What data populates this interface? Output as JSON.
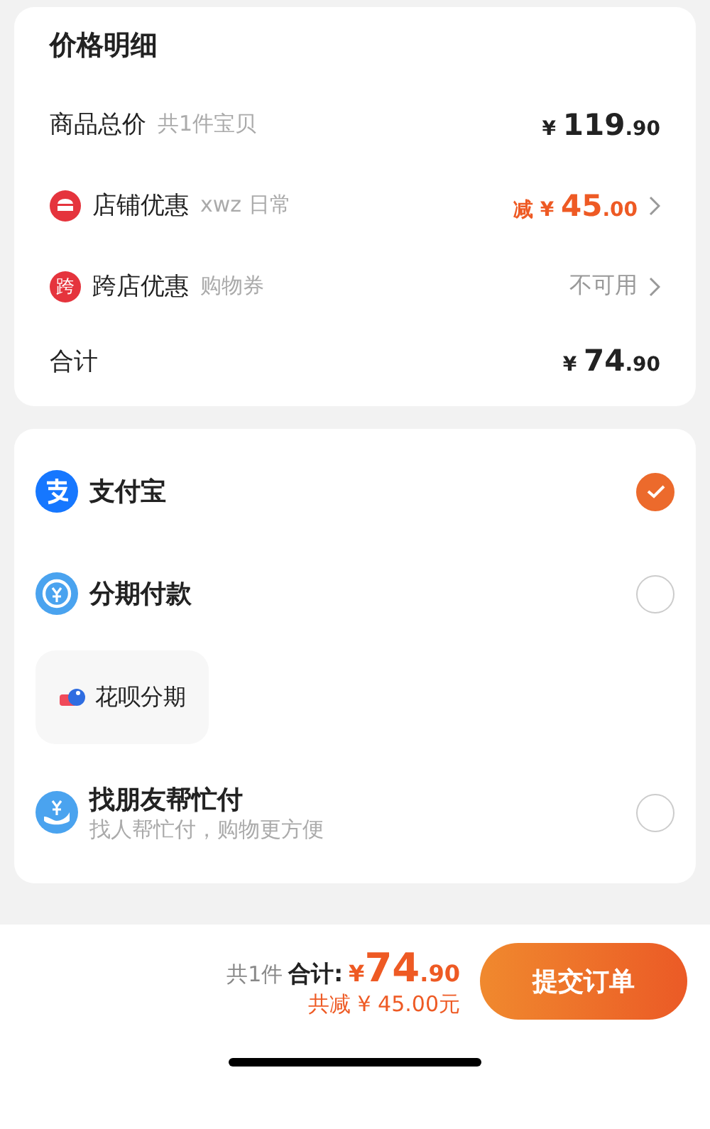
{
  "price_details": {
    "title": "价格明细",
    "rows": [
      {
        "kind": "plain",
        "label": "商品总价",
        "note": "共1件宝贝",
        "amount": {
          "currency": "¥",
          "integer": "119",
          "decimal": ".90"
        },
        "accent": false,
        "chevron": false
      },
      {
        "kind": "store",
        "label": "店铺优惠",
        "note": "xwz 日常",
        "amount": {
          "prefix": "减",
          "currency": "¥",
          "integer": "45",
          "decimal": ".00"
        },
        "accent": true,
        "chevron": true
      },
      {
        "kind": "cross",
        "badge": "跨",
        "label": "跨店优惠",
        "note": "购物券",
        "status": "不可用",
        "chevron": true
      },
      {
        "kind": "plain",
        "label": "合计",
        "amount": {
          "currency": "¥",
          "integer": "74",
          "decimal": ".90"
        },
        "accent": false,
        "chevron": false
      }
    ]
  },
  "payment_methods": [
    {
      "kind": "alipay",
      "label": "支付宝",
      "selected": true
    },
    {
      "kind": "installment",
      "label": "分期付款",
      "selected": false,
      "options": [
        {
          "label": "花呗分期"
        }
      ]
    },
    {
      "kind": "friend",
      "label": "找朋友帮忙付",
      "subtitle": "找人帮忙付，购物更方便",
      "selected": false
    }
  ],
  "footer": {
    "count": "共1件",
    "total_label": "合计:",
    "currency": "¥",
    "integer": "74",
    "decimal": ".90",
    "saving": "共减 ¥ 45.00元",
    "submit": "提交订单"
  }
}
